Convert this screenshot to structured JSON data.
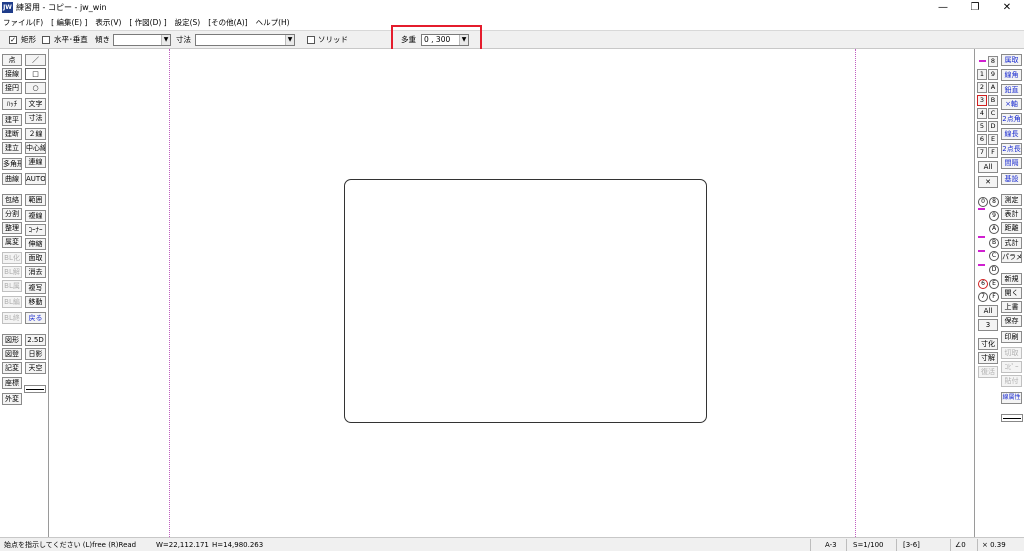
{
  "window": {
    "icon_text": "JW",
    "title": "練習用 - コピー - jw_win",
    "minimize": "—",
    "maximize": "❐",
    "close": "✕"
  },
  "menu": [
    "ファイル(F)",
    "[ 編集(E) ]",
    "表示(V)",
    "[ 作図(D) ]",
    "設定(S)",
    "[その他(A)]",
    "ヘルプ(H)"
  ],
  "controlbar": {
    "rect_check": "✓",
    "rect_label": "矩形",
    "hv_label": "水平･垂直",
    "angle_label": "傾き",
    "angle_value": "",
    "dimension_label": "寸法",
    "dimension_value": "",
    "solid_label": "ソリッド",
    "multi_label": "多重",
    "multi_value": "0 , 300",
    "dropdown_arrow": "▼"
  },
  "left_tools": {
    "col1": [
      "点",
      "接線",
      "接円",
      "ﾊｯﾁ",
      "建平",
      "建断",
      "建立",
      "多角形",
      "曲線",
      "包絡",
      "分割",
      "整理",
      "属変",
      "BL化",
      "BL解",
      "BL属",
      "BL編",
      "BL終",
      "図形",
      "図登",
      "記変",
      "座標",
      "外変"
    ],
    "col2": [
      "／",
      "□",
      "○",
      "文字",
      "寸法",
      "２線",
      "中心線",
      "連線",
      "AUTO",
      "範囲",
      "複線",
      "ｺｰﾅｰ",
      "伸縮",
      "面取",
      "消去",
      "複写",
      "移動",
      "戻る",
      "2.5D",
      "日影",
      "天空"
    ]
  },
  "right_tools": {
    "layer_group_nums": [
      "0",
      "1",
      "2",
      "3",
      "4",
      "5",
      "6",
      "7"
    ],
    "layer_group_chars": [
      "8",
      "9",
      "A",
      "B",
      "C",
      "D",
      "E",
      "F"
    ],
    "layer_all": "All",
    "layer_x": "✕",
    "layers_circ_left": [
      "0",
      "1",
      "2",
      "3",
      "4",
      "5",
      "6",
      "7"
    ],
    "layers_circ_right": [
      "8",
      "9",
      "A",
      "B",
      "C",
      "D",
      "E",
      "F"
    ],
    "layers_all": "All",
    "layers_num": "3",
    "col_a": [
      "寸化",
      "寸解",
      "復活"
    ],
    "col_b1": [
      "属取",
      "線角",
      "鉛直",
      "×軸",
      "2点角",
      "線長",
      "2点長",
      "間隔",
      "基設"
    ],
    "col_b2": [
      "測定",
      "表計",
      "距離",
      "式計",
      "パラメ"
    ],
    "col_b3": [
      "新規",
      "開く",
      "上書",
      "保存",
      "印刷",
      "切取",
      "ｺﾋﾟｰ",
      "貼付",
      "線属性"
    ]
  },
  "status": {
    "prompt": "始点を指示してください (L)free (R)Read",
    "width": "W=22,112.171",
    "height": "H=14,980.263",
    "paper": "A-3",
    "scale": "S=1/100",
    "layer": "[3-6]",
    "angle": "∠0",
    "zoom": "× 0.39"
  }
}
